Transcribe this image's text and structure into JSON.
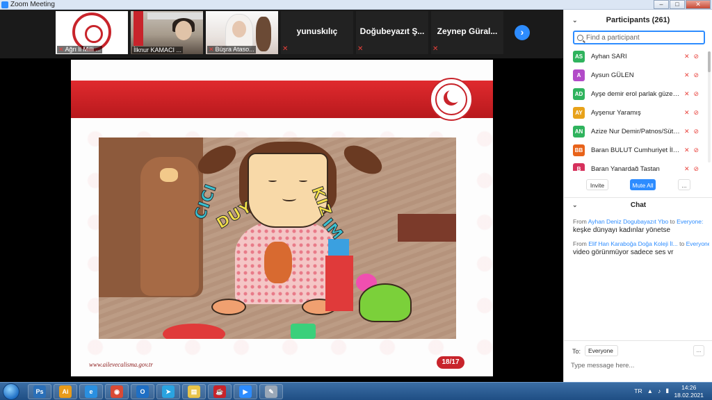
{
  "window": {
    "title": "Zoom Meeting",
    "minimize": "–",
    "maximize": "□",
    "close": "✕"
  },
  "videos": [
    {
      "caption": "Ağrı İl Milli ...",
      "muted": true
    },
    {
      "caption": "İlknur KAMACI ..."
    },
    {
      "caption": "Büşra Ataso...",
      "muted": true
    },
    {
      "name": "yunuskılıç",
      "muted": true
    },
    {
      "name": "Doğubeyazıt Ş...",
      "muted": true
    },
    {
      "name": "Zeynep Güral...",
      "muted": true
    }
  ],
  "video_next_icon": "chevron-right-icon",
  "slide": {
    "url": "www.ailevecalisma.gov.tr",
    "page": "18/17",
    "cartoon_words": [
      "CICI",
      "DUY",
      "KIZ",
      "IM"
    ],
    "band_color": "#c8242b"
  },
  "participants": {
    "title": "Participants (261)",
    "collapse": "⌄",
    "search_placeholder": "Find a participant",
    "list": [
      {
        "initials": "AS",
        "name": "Ayhan SARI",
        "color": "#2fb35d"
      },
      {
        "initials": "A",
        "name": "Aysun GÜLEN",
        "color": "#b24bc8"
      },
      {
        "initials": "AD",
        "name": "Ayşe demir erol parlak güzel sa...",
        "color": "#2fb35d"
      },
      {
        "initials": "AY",
        "name": "Ayşenur Yaramış",
        "color": "#e8a21a"
      },
      {
        "initials": "AN",
        "name": "Azize Nur Demir/Patnos/Sütlüpi...",
        "color": "#2fb35d"
      },
      {
        "initials": "BB",
        "name": "Baran BULUT Cumhuriyet İlkok...",
        "color": "#e8631a"
      },
      {
        "initials": "B",
        "name": "Baran Yanardağ Taştan",
        "color": "#d6315c"
      }
    ],
    "invite": "Invite",
    "mute_all": "Mute All",
    "more": "..."
  },
  "chat": {
    "title": "Chat",
    "collapse": "⌄",
    "messages": [
      {
        "from_label": "From",
        "sender": "Ayhan Deniz Dogubayazıt Ybo",
        "to_label": "to",
        "recipient": "Everyone:",
        "text": "keşke dünyayı kadınlar yönetse"
      },
      {
        "from_label": "From",
        "sender": "Elif Han Karaboğa Doğa Koleji İl...",
        "to_label": "to",
        "recipient": "Everyone:",
        "text": "video görünmüyor sadece ses vr"
      }
    ],
    "to_label": "To:",
    "to_value": "Everyone ⌄",
    "more": "...",
    "input_placeholder": "Type message here..."
  },
  "taskbar": {
    "apps": [
      {
        "label": "Ps",
        "color": "#2a6fb8"
      },
      {
        "label": "Ai",
        "color": "#e89b1a"
      },
      {
        "label": "e",
        "color": "#2a8fe0"
      },
      {
        "label": "◉",
        "color": "#d94a35"
      },
      {
        "label": "O",
        "color": "#1f6fc4"
      },
      {
        "label": "➤",
        "color": "#2aa3e0"
      },
      {
        "label": "▤",
        "color": "#e8c44a"
      },
      {
        "label": "☕",
        "color": "#c8242b"
      },
      {
        "label": "▶",
        "color": "#2d8cff"
      },
      {
        "label": "✎",
        "color": "#9aa8b8"
      }
    ],
    "tray_lang": "TR",
    "time": "14:26",
    "date": "18.02.2021"
  }
}
